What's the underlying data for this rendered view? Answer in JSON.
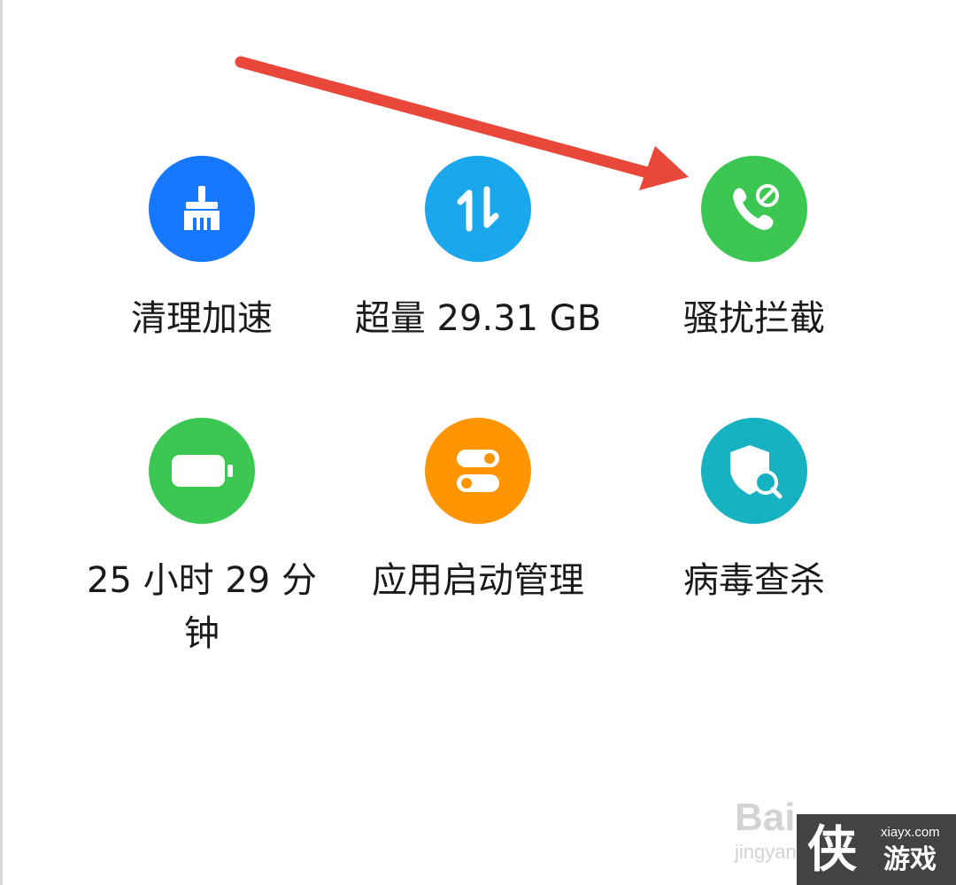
{
  "tiles": [
    {
      "label": "清理加速",
      "icon": "broom-icon",
      "color": "#1677ff"
    },
    {
      "label": "超量 29.31 GB",
      "icon": "data-transfer-icon",
      "color": "#1aa7ec"
    },
    {
      "label": "骚扰拦截",
      "icon": "call-block-icon",
      "color": "#3cc752"
    },
    {
      "label": "25 小时 29 分\n钟",
      "icon": "battery-icon",
      "color": "#3cc752"
    },
    {
      "label": "应用启动管理",
      "icon": "toggle-switches-icon",
      "color": "#ff9500"
    },
    {
      "label": "病毒查杀",
      "icon": "shield-search-icon",
      "color": "#17b2c2"
    }
  ],
  "annotation": {
    "arrow_color": "#e8473a"
  },
  "watermarks": {
    "baidu_logo": "Bai",
    "baidu_sub": "jingyan",
    "site_logo": "侠",
    "site_url": "xiayx.com",
    "site_name": "游戏"
  }
}
